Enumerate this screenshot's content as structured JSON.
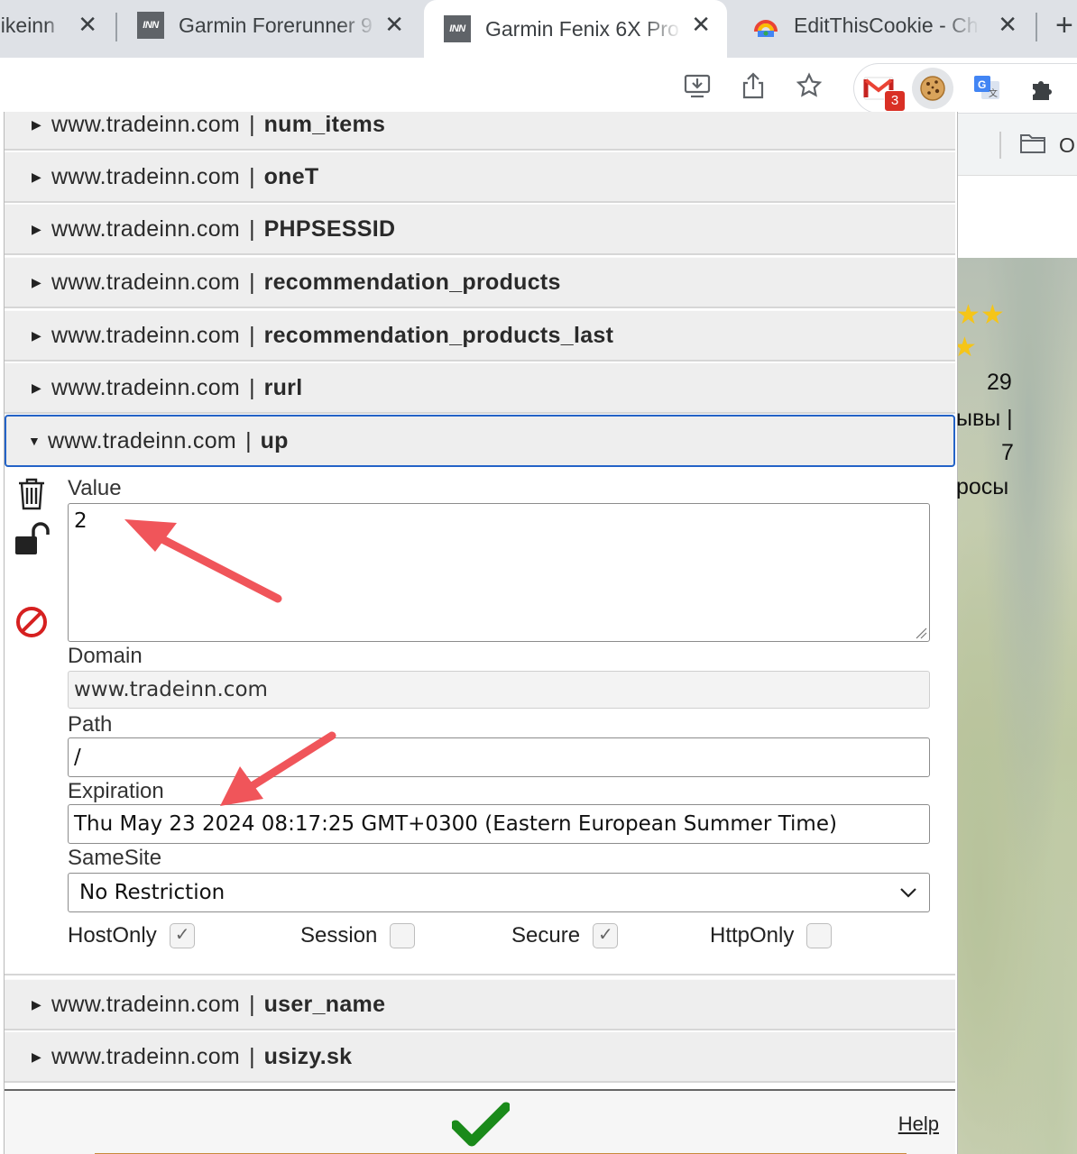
{
  "tabs": [
    {
      "title": "bikeinn",
      "favicon": "inn-logo-icon",
      "active": false
    },
    {
      "title": "Garmin Forerunner 9",
      "favicon": "inn-logo-icon",
      "active": false
    },
    {
      "title": "Garmin Fenix 6X Pro",
      "favicon": "inn-logo-icon",
      "active": true
    },
    {
      "title": "EditThisCookie - Ch",
      "favicon": "chrome-webstore-icon",
      "active": false
    }
  ],
  "new_tab": "+",
  "close_glyph": "✕",
  "toolbar": {
    "icons": [
      "install-app-icon",
      "share-icon",
      "bookmark-star-icon"
    ],
    "extensions": [
      "gmail-extension-icon",
      "cookie-extension-icon",
      "translate-extension-icon",
      "puzzle-extensions-icon"
    ],
    "gmail_badge": "3"
  },
  "background_page": {
    "bookmark_label": "O",
    "rating_count": "29",
    "reviews_fragment": "ывы |",
    "questions_count": "7",
    "questions_fragment": "росы"
  },
  "cookies": {
    "domain": "www.tradeinn.com",
    "separator": "|",
    "rows_above": [
      "num_items",
      "oneT",
      "PHPSESSID",
      "recommendation_products",
      "recommendation_products_last",
      "rurl"
    ],
    "open_row": "up",
    "rows_below": [
      "user_name",
      "usizy.sk"
    ]
  },
  "detail": {
    "value_label": "Value",
    "value": "2",
    "domain_label": "Domain",
    "domain": "www.tradeinn.com",
    "path_label": "Path",
    "path": "/",
    "expiration_label": "Expiration",
    "expiration": "Thu May 23 2024 08:17:25 GMT+0300 (Eastern European Summer Time)",
    "samesite_label": "SameSite",
    "samesite": "No Restriction",
    "flags": [
      {
        "label": "HostOnly",
        "checked": true
      },
      {
        "label": "Session",
        "checked": false
      },
      {
        "label": "Secure",
        "checked": true
      },
      {
        "label": "HttpOnly",
        "checked": false
      }
    ]
  },
  "footer": {
    "help": "Help"
  },
  "colors": {
    "selected_border": "#2463c7",
    "annotation_arrow": "#f0555a",
    "confirm_green": "#1a8a1a",
    "block_red": "#d62020"
  }
}
